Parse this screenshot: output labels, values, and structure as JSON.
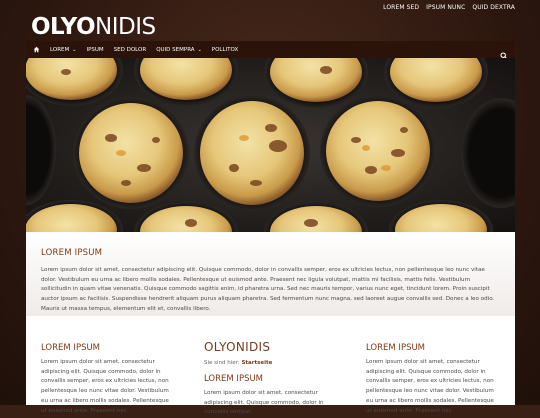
{
  "header": {
    "logo_bold": "OLYO",
    "logo_light": "NIDIS",
    "top_links": [
      "LOREM SED",
      "IPSUM NUNC",
      "QUID DEXTRA"
    ]
  },
  "nav": {
    "items": [
      {
        "label": "LOREM",
        "dropdown": true
      },
      {
        "label": "IPSUM",
        "dropdown": false
      },
      {
        "label": "SED DOLOR",
        "dropdown": false
      },
      {
        "label": "QUID SEMPRA",
        "dropdown": true
      },
      {
        "label": "POLLITOX",
        "dropdown": false
      }
    ],
    "home_icon": "home-icon",
    "search_icon": "search-icon"
  },
  "intro": {
    "title": "LOREM IPSUM",
    "text": "Lorem ipsum dolor sit amet, consectetur adipiscing elit. Quisque commodo, dolor in convallis semper, eros ex ultricies lectus, non pellentesque leo nunc vitae dolor. Vestibulum eu urna ac libero mollis sodales. Pellentesque ut euismod ante. Praesent nec ligula volutpat, mattis mi facilisis, mattis felis. Vestibulum sollicitudin in quam vitae venenatis. Quisque commodo sagittis enim, id pharetra urna. Sed nec mauris tempor, varius nunc eget, tincidunt lorem. Proin suscipit auctor ipsum ac facilisis. Suspendisse hendrerit aliquam purus aliquam pharetra. Sed fermentum nunc magna, sed laoreet augue convallis sed. Donec a leo odio. Mauris ut massa tempus, elementum elit et, convallis libero."
  },
  "columns": {
    "left": {
      "title": "LOREM IPSUM",
      "text": "Lorem ipsum dolor sit amet, consectetur adipiscing elit. Quisque commodo, dolor in convallis semper, eros ex ultricies lectus, non pellentesque leo nunc vitae dolor. Vestibulum eu urna ac libero mollis sodales. Pellentesque ut euismod ante. Praesent nec"
    },
    "center": {
      "title": "OLYONIDIS",
      "crumb_prefix": "Sie sind hier:",
      "crumb_link": "Startseite",
      "subtitle": "LOREM IPSUM",
      "text": "Lorem ipsum dolor sit amet, consectetur adipiscing elit. Quisque commodo, dolor in convallis semper,"
    },
    "right": {
      "title": "LOREM IPSUM",
      "text": "Lorem ipsum dolor sit amet, consectetur adipiscing elit. Quisque commodo, dolor in convallis semper, eros ex ultricies lectus, non pellentesque leo nunc vitae dolor. Vestibulum eu urna ac libero mollis sodales. Pellentesque ut euismod ante. Praesent nec"
    }
  },
  "colors": {
    "accent": "#7a3a1a",
    "nav_bg": "#2b130a",
    "page_bg": "#3a1f14"
  }
}
